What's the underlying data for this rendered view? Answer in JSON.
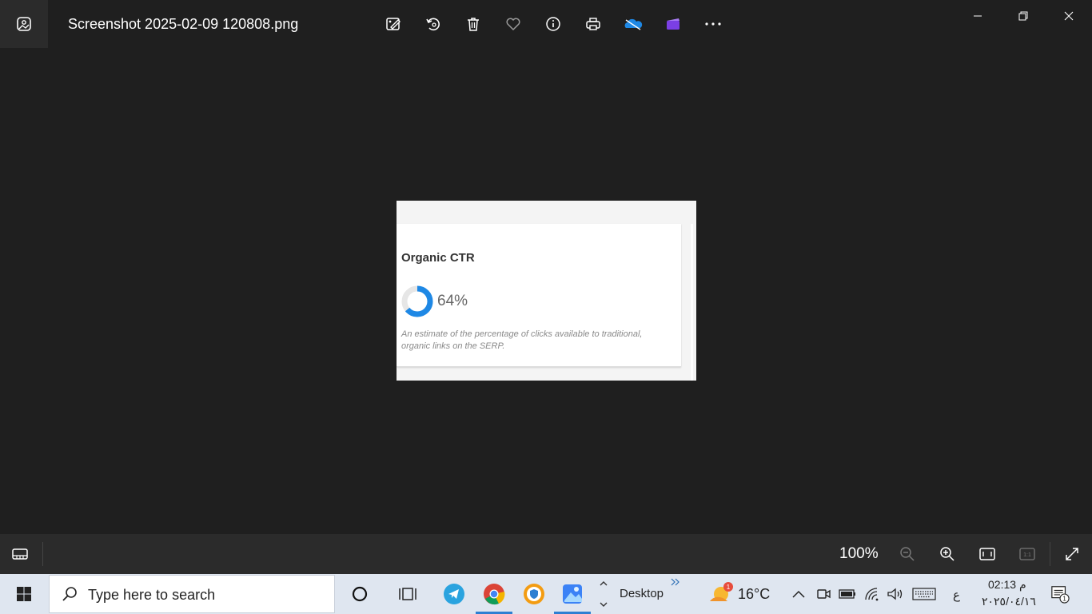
{
  "window": {
    "title": "Screenshot 2025-02-09 120808.png",
    "toolbar": [
      "edit-image-icon",
      "rotate-icon",
      "delete-icon",
      "favorite-icon",
      "info-icon",
      "print-icon",
      "onedrive-icon",
      "clipchamp-icon",
      "more-icon"
    ],
    "controls": [
      "minimize-icon",
      "restore-icon",
      "close-icon"
    ]
  },
  "card": {
    "title": "Organic CTR",
    "percent_label": "64%",
    "percent_value": 0.64,
    "description": "An estimate of the percentage of clicks available to traditional, organic links on the SERP."
  },
  "bottombar": {
    "zoom_label": "100%"
  },
  "taskbar": {
    "search_placeholder": "Type here to search",
    "desktop_label": "Desktop",
    "weather_temp": "16°C",
    "weather_badge": "1",
    "lang": "ع",
    "clock_time": "02:13 م",
    "clock_date": "٢٠٢٥/٠٤/١٦",
    "notification_count": "1"
  },
  "colors": {
    "accent": "#2d7fd2",
    "donut_fill": "#1e88e5",
    "donut_track": "#e6e6e6"
  }
}
